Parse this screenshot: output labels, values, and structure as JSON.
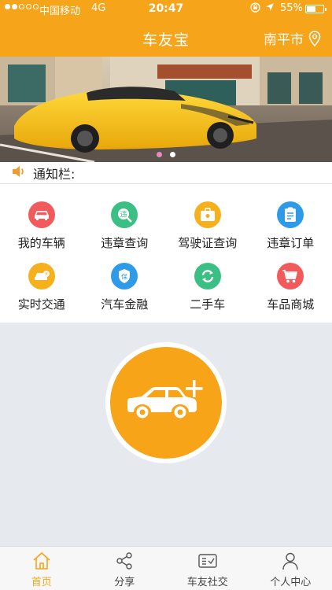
{
  "status_bar": {
    "carrier": "中国移动",
    "network": "4G",
    "time": "20:47",
    "battery_percent": "55%",
    "battery_level": 0.55,
    "signal_filled": 2,
    "signal_total": 5
  },
  "nav": {
    "title": "车友宝",
    "city": "南平市"
  },
  "banner": {
    "page_count": 2,
    "active_page": 0
  },
  "notice": {
    "label": "通知栏:"
  },
  "features": [
    {
      "label": "我的车辆",
      "icon": "car-icon",
      "color": "#f25b5b"
    },
    {
      "label": "违章查询",
      "icon": "violation-search-icon",
      "color": "#3bbf84"
    },
    {
      "label": "驾驶证查询",
      "icon": "license-icon",
      "color": "#f6b01c"
    },
    {
      "label": "违章订单",
      "icon": "order-icon",
      "color": "#2f9be8"
    },
    {
      "label": "实时交通",
      "icon": "traffic-icon",
      "color": "#f6b01c"
    },
    {
      "label": "汽车金融",
      "icon": "finance-shield-icon",
      "color": "#2f9be8"
    },
    {
      "label": "二手车",
      "icon": "refresh-icon",
      "color": "#3bbf84"
    },
    {
      "label": "车品商城",
      "icon": "cart-icon",
      "color": "#f25b5b"
    }
  ],
  "feature_glyphs": {
    "violation": "违",
    "finance": "保"
  },
  "tabs": [
    {
      "label": "首页",
      "icon": "home-icon",
      "active": true
    },
    {
      "label": "分享",
      "icon": "share-icon",
      "active": false
    },
    {
      "label": "车友社交",
      "icon": "social-icon",
      "active": false
    },
    {
      "label": "个人中心",
      "icon": "person-icon",
      "active": false
    }
  ],
  "colors": {
    "accent": "#f6a41a",
    "background": "#e6e9ee"
  }
}
